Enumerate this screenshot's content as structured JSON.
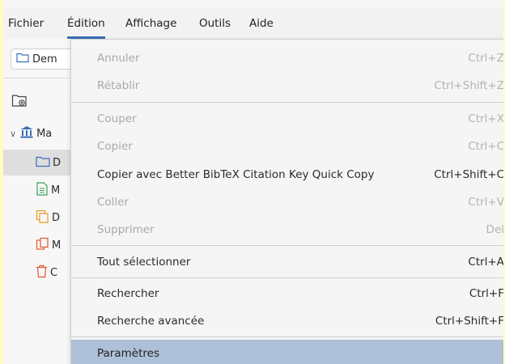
{
  "menubar": {
    "items": [
      {
        "label": "Fichier"
      },
      {
        "label": "Édition",
        "active": true
      },
      {
        "label": "Affichage"
      },
      {
        "label": "Outils"
      },
      {
        "label": "Aide"
      }
    ]
  },
  "toolbar": {
    "collection_button_label": "Dem"
  },
  "tree": {
    "library_label": "Ma",
    "rows": [
      {
        "icon": "folder-icon",
        "label": "D",
        "selected": true
      },
      {
        "icon": "document-icon",
        "label": "M"
      },
      {
        "icon": "duplicate-icon",
        "label": "D"
      },
      {
        "icon": "unfiled-icon",
        "label": "M"
      },
      {
        "icon": "trash-icon",
        "label": "C"
      }
    ]
  },
  "edit_menu": {
    "items": [
      {
        "label": "Annuler",
        "shortcut": "Ctrl+Z",
        "disabled": true
      },
      {
        "label": "Rétablir",
        "shortcut": "Ctrl+Shift+Z",
        "disabled": true
      },
      {
        "label": "Couper",
        "shortcut": "Ctrl+X",
        "disabled": true
      },
      {
        "label": "Copier",
        "shortcut": "Ctrl+C",
        "disabled": true
      },
      {
        "label": "Copier avec Better BibTeX Citation Key Quick Copy",
        "shortcut": "Ctrl+Shift+C",
        "disabled": false
      },
      {
        "label": "Coller",
        "shortcut": "Ctrl+V",
        "disabled": true
      },
      {
        "label": "Supprimer",
        "shortcut": "Del",
        "disabled": true
      },
      {
        "label": "Tout sélectionner",
        "shortcut": "Ctrl+A",
        "disabled": false
      },
      {
        "label": "Rechercher",
        "shortcut": "Ctrl+F",
        "disabled": false
      },
      {
        "label": "Recherche avancée",
        "shortcut": "Ctrl+Shift+F",
        "disabled": false
      },
      {
        "label": "Paramètres",
        "shortcut": "",
        "disabled": false,
        "highlighted": true
      }
    ]
  },
  "colors": {
    "accent": "#3b6fb6",
    "highlight": "#adc0d8",
    "desktop_background": "#fefdc0"
  }
}
